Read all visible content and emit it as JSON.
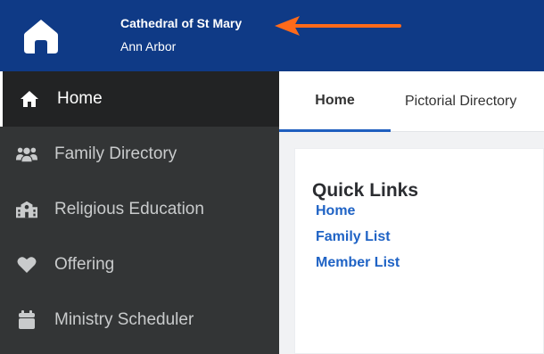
{
  "header": {
    "org_name": "Cathedral of St Mary",
    "org_city": "Ann Arbor",
    "bg_color": "#0f3a86",
    "arrow_color": "#ff6a1a",
    "logo_icon": "house-icon"
  },
  "sidebar": {
    "items": [
      {
        "label": "Home",
        "icon": "home-icon",
        "active": true
      },
      {
        "label": "Family Directory",
        "icon": "people-icon",
        "active": false
      },
      {
        "label": "Religious Education",
        "icon": "school-icon",
        "active": false
      },
      {
        "label": "Offering",
        "icon": "heart-icon",
        "active": false
      },
      {
        "label": "Ministry Scheduler",
        "icon": "calendar-icon",
        "active": false
      }
    ]
  },
  "tabs": {
    "items": [
      {
        "label": "Home",
        "active": true
      },
      {
        "label": "Pictorial Directory",
        "active": false
      }
    ]
  },
  "quick_links": {
    "title": "Quick Links",
    "links": [
      {
        "label": "Home"
      },
      {
        "label": "Family List"
      },
      {
        "label": "Member List"
      }
    ]
  }
}
